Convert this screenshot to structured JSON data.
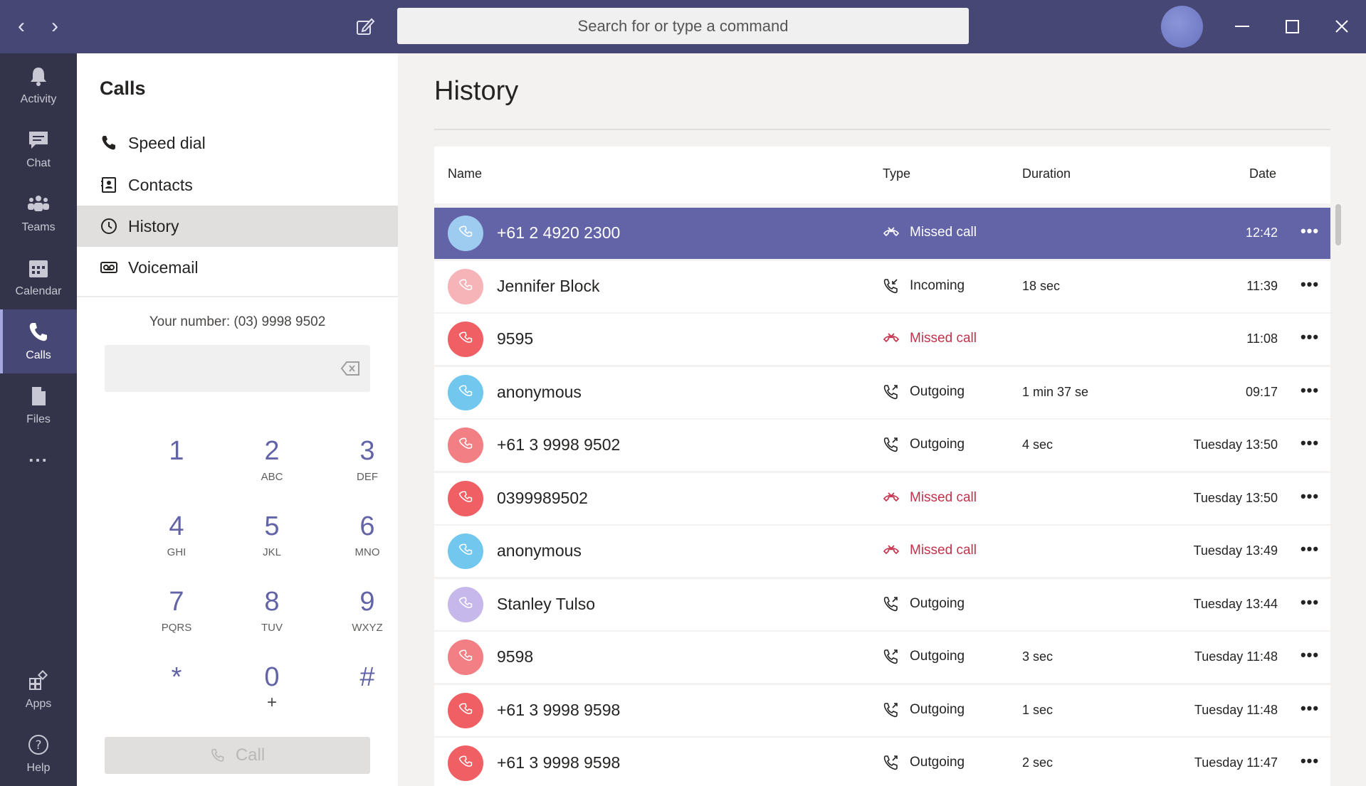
{
  "search": {
    "placeholder": "Search for or type a command"
  },
  "rail": [
    {
      "label": "Activity",
      "icon": "bell-icon"
    },
    {
      "label": "Chat",
      "icon": "chat-icon"
    },
    {
      "label": "Teams",
      "icon": "teams-icon"
    },
    {
      "label": "Calendar",
      "icon": "calendar-icon"
    },
    {
      "label": "Calls",
      "icon": "phone-icon",
      "active": true
    },
    {
      "label": "Files",
      "icon": "file-icon"
    },
    {
      "label": "...",
      "icon": "more-icon"
    },
    {
      "label": "Apps",
      "icon": "apps-icon"
    },
    {
      "label": "Help",
      "icon": "help-icon"
    }
  ],
  "panel": {
    "title": "Calls",
    "menu": [
      {
        "label": "Speed dial",
        "icon": "phone-icon"
      },
      {
        "label": "Contacts",
        "icon": "contact-card-icon"
      },
      {
        "label": "History",
        "icon": "clock-icon",
        "active": true
      },
      {
        "label": "Voicemail",
        "icon": "voicemail-icon"
      }
    ],
    "your_number": "Your number: (03) 9998 9502",
    "dial_value": "",
    "keys": [
      {
        "digit": "1",
        "letters": ""
      },
      {
        "digit": "2",
        "letters": "ABC"
      },
      {
        "digit": "3",
        "letters": "DEF"
      },
      {
        "digit": "4",
        "letters": "GHI"
      },
      {
        "digit": "5",
        "letters": "JKL"
      },
      {
        "digit": "6",
        "letters": "MNO"
      },
      {
        "digit": "7",
        "letters": "PQRS"
      },
      {
        "digit": "8",
        "letters": "TUV"
      },
      {
        "digit": "9",
        "letters": "WXYZ"
      },
      {
        "digit": "*",
        "letters": ""
      },
      {
        "digit": "0",
        "letters": "+"
      },
      {
        "digit": "#",
        "letters": ""
      }
    ],
    "call_label": "Call"
  },
  "main": {
    "title": "History",
    "columns": {
      "name": "Name",
      "type": "Type",
      "duration": "Duration",
      "date": "Date"
    },
    "rows": [
      {
        "name": "+61 2 4920 2300",
        "type": "Missed call",
        "missed": true,
        "duration": "",
        "date": "12:42",
        "avatar_color": "#9ecbf0",
        "selected": true
      },
      {
        "name": "Jennifer Block",
        "type": "Incoming",
        "missed": false,
        "duration": "18 sec",
        "date": "11:39",
        "avatar_color": "#f7b4b8"
      },
      {
        "name": "9595",
        "type": "Missed call",
        "missed": true,
        "duration": "",
        "date": "11:08",
        "avatar_color": "#ef5f63"
      },
      {
        "name": "anonymous",
        "type": "Outgoing",
        "missed": false,
        "duration": "1 min 37 se",
        "date": "09:17",
        "avatar_color": "#72c7ef"
      },
      {
        "name": "+61 3 9998 9502",
        "type": "Outgoing",
        "missed": false,
        "duration": "4 sec",
        "date": "Tuesday 13:50",
        "avatar_color": "#f27f84"
      },
      {
        "name": "0399989502",
        "type": "Missed call",
        "missed": true,
        "duration": "",
        "date": "Tuesday 13:50",
        "avatar_color": "#ef5f63"
      },
      {
        "name": "anonymous",
        "type": "Missed call",
        "missed": true,
        "duration": "",
        "date": "Tuesday 13:49",
        "avatar_color": "#72c7ef"
      },
      {
        "name": "Stanley Tulso",
        "type": "Outgoing",
        "missed": false,
        "duration": "",
        "date": "Tuesday 13:44",
        "avatar_color": "#c7b8ec"
      },
      {
        "name": "9598",
        "type": "Outgoing",
        "missed": false,
        "duration": "3 sec",
        "date": "Tuesday 11:48",
        "avatar_color": "#f27f84"
      },
      {
        "name": "+61 3 9998 9598",
        "type": "Outgoing",
        "missed": false,
        "duration": "1 sec",
        "date": "Tuesday 11:48",
        "avatar_color": "#ef5f63"
      },
      {
        "name": "+61 3 9998 9598",
        "type": "Outgoing",
        "missed": false,
        "duration": "2 sec",
        "date": "Tuesday 11:47",
        "avatar_color": "#ef5f63"
      }
    ],
    "more_label": "•••"
  },
  "colors": {
    "brand": "#464775",
    "accent": "#6264a7",
    "rail": "#33344a",
    "missed": "#c4314b"
  }
}
